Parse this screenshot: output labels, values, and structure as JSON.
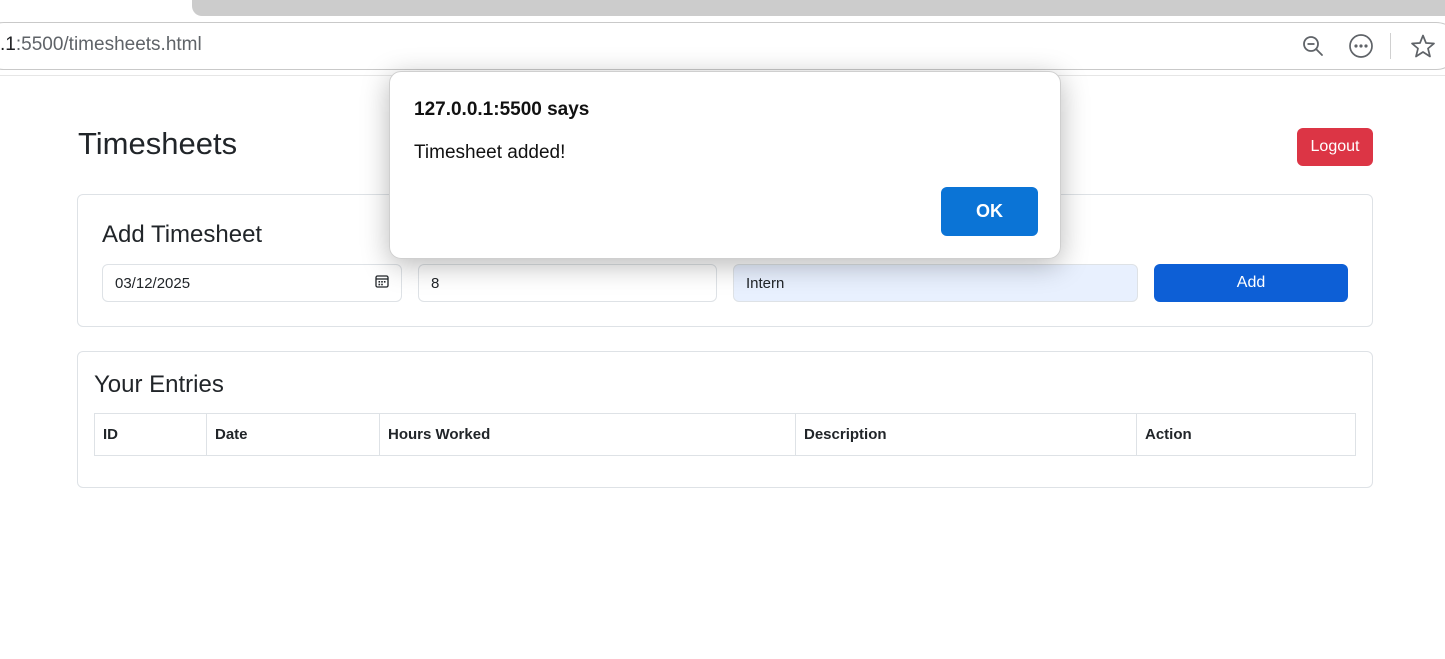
{
  "browser": {
    "url_host": ".1",
    "url_path": ":5500/timesheets.html",
    "icons": [
      "zoom-out-icon",
      "more-options-icon",
      "favorite-star-icon"
    ]
  },
  "page": {
    "title": "Timesheets",
    "logout_label": "Logout",
    "colors": {
      "logout": "#dc3545",
      "add": "#0d5fd6",
      "ok": "#0b74d6"
    }
  },
  "add_card": {
    "title": "Add Timesheet",
    "date_value": "03/12/2025",
    "hours_value": "8",
    "description_value": "Intern",
    "add_label": "Add"
  },
  "entries_card": {
    "title": "Your Entries",
    "columns": [
      "ID",
      "Date",
      "Hours Worked",
      "Description",
      "Action"
    ]
  },
  "dialog": {
    "title": "127.0.0.1:5500 says",
    "message": "Timesheet added!",
    "ok_label": "OK"
  }
}
